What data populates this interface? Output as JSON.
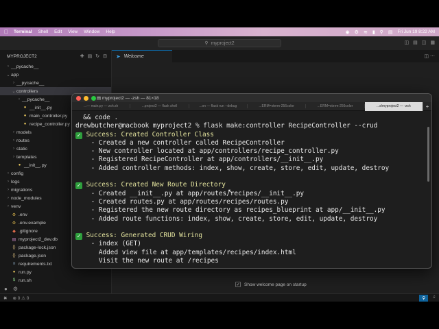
{
  "menubar": {
    "app": "Terminal",
    "items": [
      "Shell",
      "Edit",
      "View",
      "Window",
      "Help"
    ],
    "datetime": "Fri Jun 19  8:22 AM"
  },
  "vscode": {
    "search": {
      "label": "myproject2",
      "icon": "search-icon"
    },
    "sidebar": {
      "title": "MYPROJECT2",
      "items": [
        {
          "label": "__pycache__",
          "depth": 0,
          "kind": "folder",
          "open": false
        },
        {
          "label": "app",
          "depth": 0,
          "kind": "folder",
          "open": true
        },
        {
          "label": "__pycache__",
          "depth": 1,
          "kind": "folder",
          "open": false
        },
        {
          "label": "controllers",
          "depth": 1,
          "kind": "folder",
          "open": true,
          "selected": true
        },
        {
          "label": "__pycache__",
          "depth": 2,
          "kind": "folder",
          "open": false
        },
        {
          "label": "__init__.py",
          "depth": 2,
          "kind": "py"
        },
        {
          "label": "main_controller.py",
          "depth": 2,
          "kind": "py"
        },
        {
          "label": "recipe_controller.py",
          "depth": 2,
          "kind": "py"
        },
        {
          "label": "models",
          "depth": 1,
          "kind": "folder",
          "open": false
        },
        {
          "label": "routes",
          "depth": 1,
          "kind": "folder",
          "open": false
        },
        {
          "label": "static",
          "depth": 1,
          "kind": "folder",
          "open": false
        },
        {
          "label": "templates",
          "depth": 1,
          "kind": "folder",
          "open": false
        },
        {
          "label": "__init__.py",
          "depth": 1,
          "kind": "py"
        },
        {
          "label": "config",
          "depth": 0,
          "kind": "folder",
          "open": false
        },
        {
          "label": "logs",
          "depth": 0,
          "kind": "folder",
          "open": false
        },
        {
          "label": "migrations",
          "depth": 0,
          "kind": "folder",
          "open": false
        },
        {
          "label": "node_modules",
          "depth": 0,
          "kind": "folder",
          "open": false
        },
        {
          "label": "venv",
          "depth": 0,
          "kind": "folder",
          "open": false
        },
        {
          "label": ".env",
          "depth": 0,
          "kind": "env"
        },
        {
          "label": ".env.example",
          "depth": 0,
          "kind": "env"
        },
        {
          "label": ".gitignore",
          "depth": 0,
          "kind": "git"
        },
        {
          "label": "myproject2_dev.db",
          "depth": 0,
          "kind": "db"
        },
        {
          "label": "package-lock.json",
          "depth": 0,
          "kind": "json"
        },
        {
          "label": "package.json",
          "depth": 0,
          "kind": "json"
        },
        {
          "label": "requirements.txt",
          "depth": 0,
          "kind": "txt"
        },
        {
          "label": "run.py",
          "depth": 0,
          "kind": "py"
        },
        {
          "label": "run.sh",
          "depth": 0,
          "kind": "sh"
        }
      ]
    },
    "editor": {
      "tab_label": "Welcome",
      "welcome_checkbox_label": "Show welcome page on startup"
    },
    "statusbar": {
      "errors": "0",
      "warnings": "0"
    }
  },
  "terminal": {
    "title": "myproject2 — -zsh — 81×18",
    "tabs": [
      "...— main.py — zsh.sh",
      "...project2 — flask shell",
      "...on — flask run --debug",
      "...ERM=xterm-256color",
      "...ERM=xterm-256color",
      "...s/myproject2 — -zsh"
    ],
    "lines": [
      {
        "type": "text",
        "text": "  && code ."
      },
      {
        "type": "text",
        "text": "drewbutcher@macbook myproject2 % flask make:controller RecipeController --crud"
      },
      {
        "type": "success",
        "text": " Success: Created Controller Class"
      },
      {
        "type": "text",
        "text": "    - Created a new controller called RecipeController"
      },
      {
        "type": "text",
        "text": "    - New controller located at app/controllers/recipe_controller.py"
      },
      {
        "type": "text",
        "text": "    - Registered RecipeController at app/controllers/__init__.py"
      },
      {
        "type": "text",
        "text": "    - Added controller methods: index, show, create, store, edit, update, destroy"
      },
      {
        "type": "blank",
        "text": ""
      },
      {
        "type": "success",
        "text": " Success: Created New Route Directory"
      },
      {
        "type": "text",
        "text": "    - Created __init__.py at app/routes/recipes/__init__.py"
      },
      {
        "type": "text",
        "text": "    - Created routes.py at app/routes/recipes/routes.py"
      },
      {
        "type": "text",
        "text": "    - Registered the new route directory as recipes_blueprint at app/__init__.py"
      },
      {
        "type": "text",
        "text": "    - Added route functions: index, show, create, store, edit, update, destroy"
      },
      {
        "type": "blank",
        "text": ""
      },
      {
        "type": "success",
        "text": " Success: Generated CRUD Wiring"
      },
      {
        "type": "text",
        "text": "    - index (GET)"
      },
      {
        "type": "text",
        "text": "      Added view file at app/templates/recipes/index.html"
      },
      {
        "type": "text",
        "text": "      Visit the new route at /recipes"
      }
    ]
  }
}
